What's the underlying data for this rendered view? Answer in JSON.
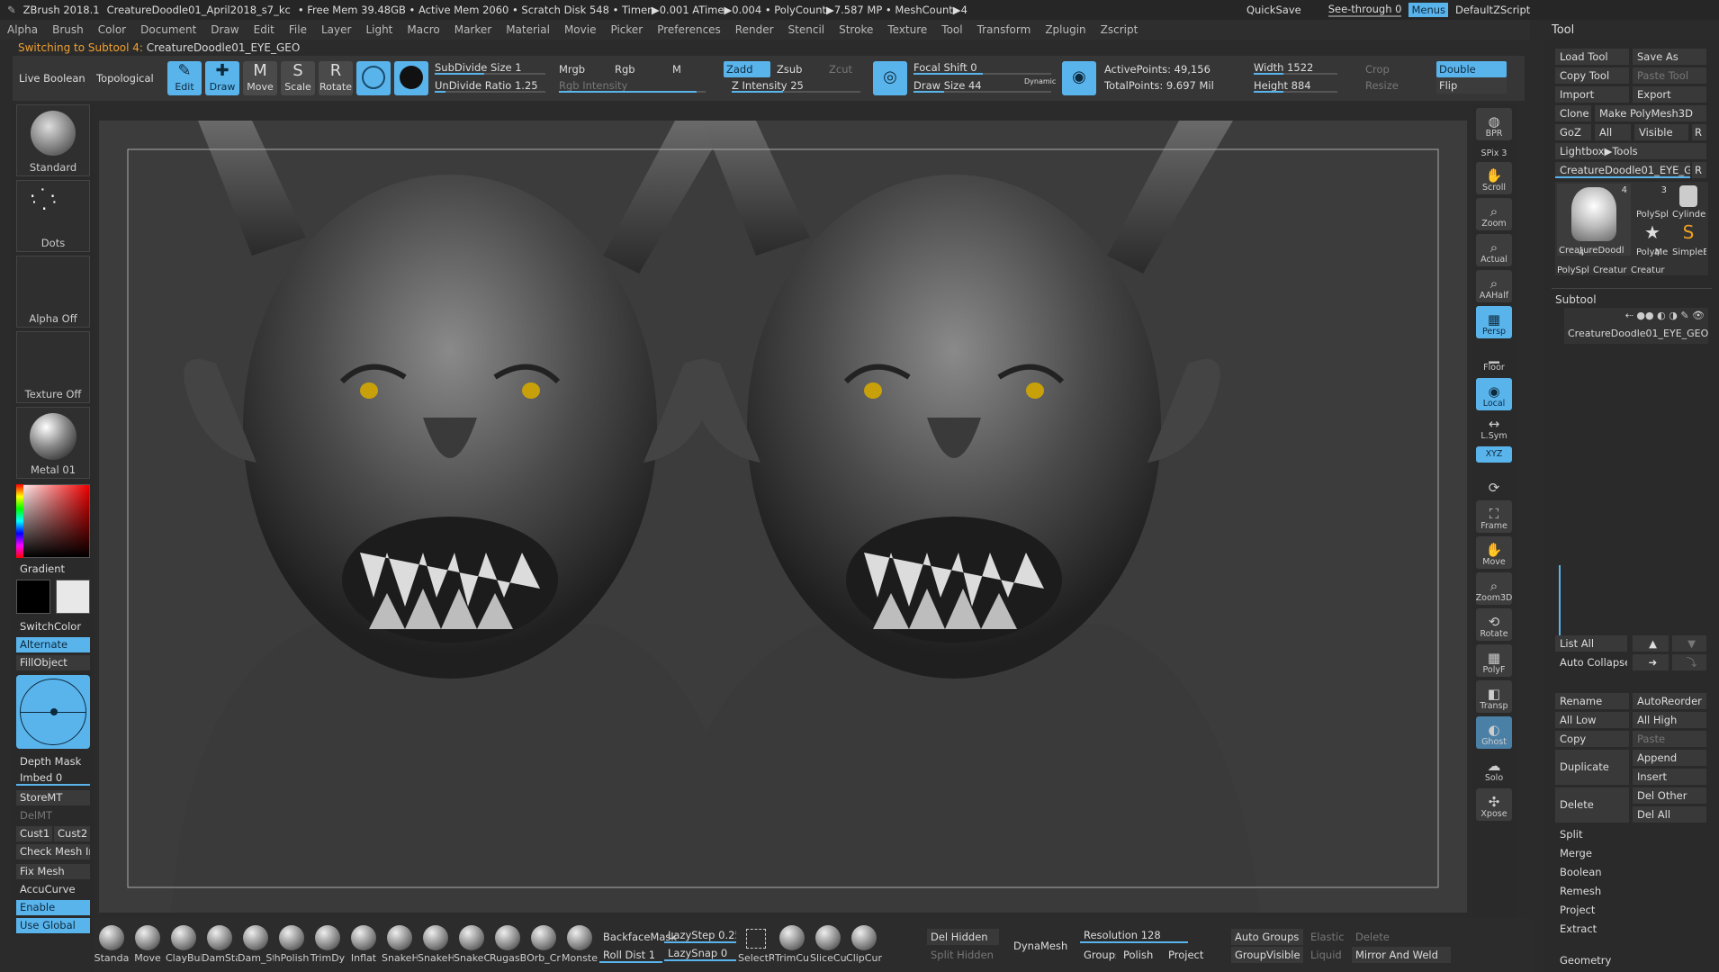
{
  "title_bar": {
    "app": "ZBrush 2018.1",
    "file": "CreatureDoodle01_April2018_s7_kc",
    "stats": "• Free Mem 39.48GB • Active Mem 2060 • Scratch Disk 548 • Timer▶0.001 ATime▶0.004 • PolyCount▶7.587 MP • MeshCount▶4",
    "quicksave": "QuickSave",
    "seethrough": "See-through 0",
    "menus": "Menus",
    "script": "DefaultZScript"
  },
  "menu": [
    "Alpha",
    "Brush",
    "Color",
    "Document",
    "Draw",
    "Edit",
    "File",
    "Layer",
    "Light",
    "Macro",
    "Marker",
    "Material",
    "Movie",
    "Picker",
    "Preferences",
    "Render",
    "Stencil",
    "Stroke",
    "Texture",
    "Tool",
    "Transform",
    "Zplugin",
    "Zscript"
  ],
  "status": {
    "switching": "Switching to Subtool 4:",
    "subtool_name": "CreatureDoodle01_EYE_GEO"
  },
  "shelf": {
    "live_boolean": "Live Boolean",
    "topological": "Topological",
    "edit": "Edit",
    "draw": "Draw",
    "move": "Move",
    "scale": "Scale",
    "rotate": "Rotate",
    "subdivide_size": "SubDivide Size 1",
    "undivide_ratio": "UnDivide Ratio 1.25",
    "mrgb": "Mrgb",
    "rgb": "Rgb",
    "m": "M",
    "rgb_intensity": "Rgb Intensity",
    "zadd": "Zadd",
    "zsub": "Zsub",
    "zcut": "Zcut",
    "z_intensity": "Z Intensity 25",
    "focal_shift": "Focal Shift 0",
    "draw_size": "Draw Size 44",
    "dynamic": "Dynamic",
    "active_points": "ActivePoints: 49,156",
    "total_points": "TotalPoints: 9.697 Mil",
    "width": "Width 1522",
    "height": "Height 884",
    "crop": "Crop",
    "resize": "Resize",
    "double": "Double",
    "flip": "Flip"
  },
  "left_shelf": {
    "brush": "Standard",
    "stroke": "Dots",
    "alpha": "Alpha Off",
    "texture": "Texture Off",
    "material": "Metal 01",
    "gradient": "Gradient",
    "switchcolor": "SwitchColor",
    "alternate": "Alternate",
    "fillobject": "FillObject",
    "depth_mask": "Depth Mask",
    "imbed": "Imbed 0",
    "storemt": "StoreMT",
    "delmt": "DelMT",
    "cust1": "Cust1",
    "cust2": "Cust2",
    "check_mesh": "Check Mesh In",
    "fix_mesh": "Fix Mesh",
    "accucurve": "AccuCurve",
    "enable": "Enable",
    "use_global": "Use Global"
  },
  "right_shelf": [
    "BPR",
    "SPix 3",
    "Scroll",
    "Zoom",
    "Actual",
    "AAHalf",
    "Persp",
    "Floor",
    "Local",
    "L.Sym",
    "XYZ",
    "Frame",
    "Move",
    "Zoom3D",
    "Rotate",
    "PolyF",
    "Transp",
    "Ghost",
    "Solo",
    "Xpose"
  ],
  "tool_palette": {
    "header": "Tool",
    "load_tool": "Load Tool",
    "save_as": "Save As",
    "copy_tool": "Copy Tool",
    "paste_tool": "Paste Tool",
    "import": "Import",
    "export": "Export",
    "clone": "Clone",
    "make_polymesh": "Make PolyMesh3D",
    "goz": "GoZ",
    "all": "All",
    "visible": "Visible",
    "r": "R",
    "lightbox_tools": "Lightbox▶Tools",
    "current_tool": "CreatureDoodle01_EYE_GEO",
    "thumb_labels": [
      "CreatureDoodl",
      "PolySpl",
      "Cylinde",
      "PolyMe",
      "SimpleE",
      "PolySpl",
      "Creatur",
      "Creatur"
    ],
    "thumb_counts": [
      "4",
      "3",
      "4",
      "4"
    ],
    "subtool_header": "Subtool",
    "subtool_item": "CreatureDoodle01_EYE_GEO",
    "list_all": "List All",
    "auto_collapse": "Auto Collapse",
    "rename": "Rename",
    "autoreorder": "AutoReorder",
    "all_low": "All Low",
    "all_high": "All High",
    "copy": "Copy",
    "paste": "Paste",
    "duplicate": "Duplicate",
    "append": "Append",
    "insert": "Insert",
    "delete": "Delete",
    "del_other": "Del Other",
    "del_all": "Del All",
    "split": "Split",
    "merge": "Merge",
    "boolean": "Boolean",
    "remesh": "Remesh",
    "project": "Project",
    "extract": "Extract",
    "geometry": "Geometry"
  },
  "bottom_shelf": {
    "brushes": [
      "Standa",
      "Move",
      "ClayBui",
      "DamSta",
      "Dam_St",
      "hPolish",
      "TrimDy",
      "Inflat",
      "SnakeH",
      "SnakeH",
      "SnakeC",
      "RugasB",
      "Orb_Cr",
      "Monste",
      "SelectR",
      "TrimCu",
      "SliceCu",
      "ClipCur"
    ],
    "backface_mask": "BackfaceMask",
    "lazystep": "LazyStep 0.25",
    "roll_dist": "Roll Dist 1",
    "lazysnap": "LazySnap 0",
    "del_hidden": "Del Hidden",
    "split_hidden": "Split Hidden",
    "dynamesh": "DynaMesh",
    "resolution": "Resolution 128",
    "groups": "Groups",
    "polish": "Polish",
    "project": "Project",
    "auto_groups": "Auto Groups",
    "elastic": "Elastic",
    "delete": "Delete",
    "groupvisible": "GroupVisible",
    "liquid": "Liquid",
    "mirror_weld": "Mirror And Weld"
  },
  "colors": {
    "accent": "#5ab4ec",
    "bg": "#2b2b2b",
    "panel": "#363636",
    "canvas": "#3a3a3a"
  }
}
